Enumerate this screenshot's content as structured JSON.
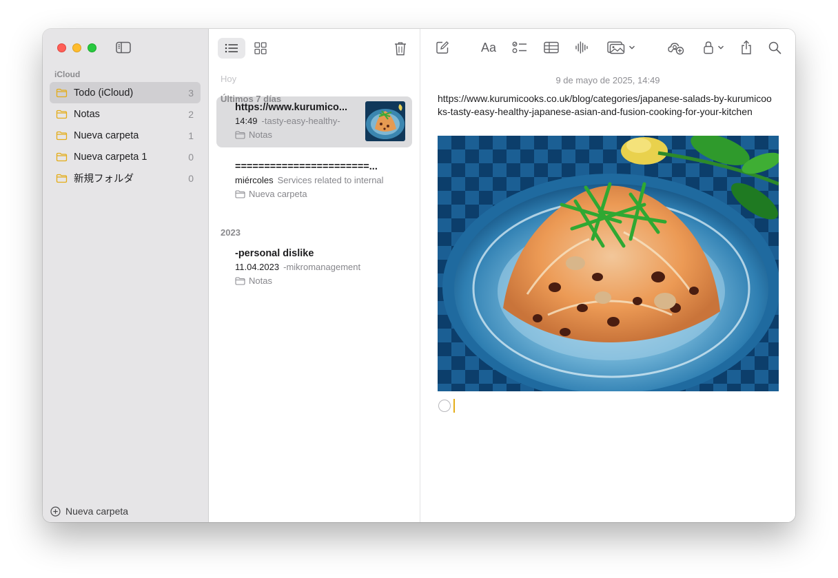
{
  "sidebar": {
    "section_label": "iCloud",
    "folders": [
      {
        "name": "Todo (iCloud)",
        "count": "3"
      },
      {
        "name": "Notas",
        "count": "2"
      },
      {
        "name": "Nueva carpeta",
        "count": "1"
      },
      {
        "name": "Nueva carpeta 1",
        "count": "0"
      },
      {
        "name": "新規フォルダ",
        "count": "0"
      }
    ],
    "new_folder_label": "Nueva carpeta"
  },
  "list": {
    "groups": [
      "Hoy",
      "Últimos 7 días",
      "2023"
    ],
    "notes": [
      {
        "title": "https://www.kurumico...",
        "date": "14:49",
        "preview": "-tasty-easy-healthy-",
        "folder": "Notas"
      },
      {
        "title": "=======================...",
        "date": "miércoles",
        "preview": "Services related to internal",
        "folder": "Nueva carpeta"
      },
      {
        "title": "-personal dislike",
        "date": "11.04.2023",
        "preview": "-mikromanagement",
        "folder": "Notas"
      }
    ]
  },
  "editor": {
    "date": "9 de mayo de 2025, 14:49",
    "url_text": "https://www.kurumicooks.co.uk/blog/categories/japanese-salads-by-kurumicooks-tasty-easy-healthy-japanese-asian-and-fusion-cooking-for-your-kitchen",
    "format_label": "Aa"
  },
  "icons": {
    "sidebar_toggle": "sidebar-icon",
    "list_view": "list-icon",
    "gallery_view": "grid-icon",
    "delete": "trash-icon",
    "compose": "compose-icon",
    "checklist": "checklist-icon",
    "table": "table-icon",
    "audio": "waveform-icon",
    "media": "photo-icon",
    "collaborate": "collaborate-icon",
    "lock": "lock-icon",
    "share": "share-icon",
    "search": "search-icon"
  },
  "colors": {
    "accent": "#e4ac17",
    "sidebar_bg": "#e6e5e7",
    "selection": "#d0cfd2"
  }
}
